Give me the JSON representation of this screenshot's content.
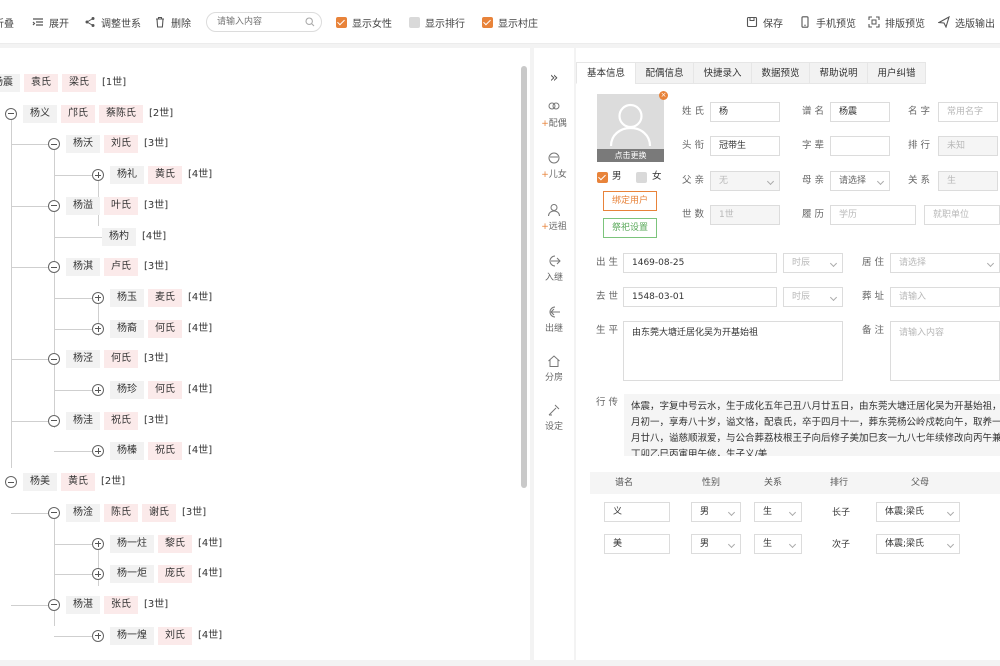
{
  "toolbar": {
    "collapse": "折叠",
    "expand": "展开",
    "adjust": "调整世系",
    "delete": "删除",
    "search_placeholder": "请输入内容",
    "show_female": "显示女性",
    "show_rank": "显示排行",
    "show_village": "显示村庄",
    "save": "保存",
    "phone_preview": "手机预览",
    "layout_preview": "排版预览",
    "export": "选版输出"
  },
  "tree": {
    "root": {
      "name": "杨震",
      "spouses": [
        "袁氏",
        "梁氏"
      ],
      "gen": "[1世]"
    },
    "nodes": [
      {
        "name": "杨义",
        "spouses": [
          "邝氏",
          "蔡陈氏"
        ],
        "gen": "[2世]"
      },
      {
        "name": "杨沃",
        "spouses": [
          "刘氏"
        ],
        "gen": "[3世]"
      },
      {
        "name": "杨礼",
        "spouses": [
          "黄氏"
        ],
        "gen": "[4世]"
      },
      {
        "name": "杨溢",
        "spouses": [
          "叶氏"
        ],
        "gen": "[3世]"
      },
      {
        "name": "杨杓",
        "spouses": [],
        "gen": "[4世]"
      },
      {
        "name": "杨淇",
        "spouses": [
          "卢氏"
        ],
        "gen": "[3世]"
      },
      {
        "name": "杨玉",
        "spouses": [
          "麦氏"
        ],
        "gen": "[4世]"
      },
      {
        "name": "杨裔",
        "spouses": [
          "何氏"
        ],
        "gen": "[4世]"
      },
      {
        "name": "杨泾",
        "spouses": [
          "何氏"
        ],
        "gen": "[3世]"
      },
      {
        "name": "杨珍",
        "spouses": [
          "何氏"
        ],
        "gen": "[4世]"
      },
      {
        "name": "杨洼",
        "spouses": [
          "祝氏"
        ],
        "gen": "[3世]"
      },
      {
        "name": "杨榛",
        "spouses": [
          "祝氏"
        ],
        "gen": "[4世]"
      },
      {
        "name": "杨美",
        "spouses": [
          "黄氏"
        ],
        "gen": "[2世]"
      },
      {
        "name": "杨淦",
        "spouses": [
          "陈氏",
          "谢氏"
        ],
        "gen": "[3世]"
      },
      {
        "name": "杨一炷",
        "spouses": [
          "黎氏"
        ],
        "gen": "[4世]"
      },
      {
        "name": "杨一炬",
        "spouses": [
          "庞氏"
        ],
        "gen": "[4世]"
      },
      {
        "name": "杨湛",
        "spouses": [
          "张氏"
        ],
        "gen": "[3世]"
      },
      {
        "name": "杨一煌",
        "spouses": [
          "刘氏"
        ],
        "gen": "[4世]"
      }
    ]
  },
  "sidenav": {
    "expand_icon": "»",
    "items": [
      {
        "label": "配偶",
        "icon": "couple-icon",
        "plus": true
      },
      {
        "label": "儿女",
        "icon": "child-icon",
        "plus": true
      },
      {
        "label": "远祖",
        "icon": "ancestor-icon",
        "plus": true
      },
      {
        "label": "入继",
        "icon": "adopt-in-icon",
        "plus": false
      },
      {
        "label": "出继",
        "icon": "adopt-out-icon",
        "plus": false
      },
      {
        "label": "分房",
        "icon": "house-icon",
        "plus": false
      },
      {
        "label": "设定",
        "icon": "settings-icon",
        "plus": false
      }
    ]
  },
  "form": {
    "tabs": [
      "基本信息",
      "配偶信息",
      "快捷录入",
      "数据预览",
      "帮助说明",
      "用户纠错"
    ],
    "avatar_caption": "点击更换",
    "gender_male": "男",
    "gender_female": "女",
    "bind_user": "绑定用户",
    "memorial": "祭祀设置",
    "labels": {
      "surname": "姓 氏",
      "genealogy_name": "谱 名",
      "given_name": "名 字",
      "title": "头 衔",
      "courtesy": "字 辈",
      "rank": "排 行",
      "father": "父 亲",
      "mother": "母 亲",
      "relation": "关 系",
      "generation": "世 数",
      "resume": "履 历",
      "birth": "出 生",
      "residence": "居 住",
      "death": "去 世",
      "burial": "葬 址",
      "life": "生 平",
      "note": "备 注",
      "biography": "行 传"
    },
    "values": {
      "surname": "杨",
      "genealogy_name": "杨震",
      "given_name_ph": "常用名字",
      "title": "冠带生",
      "courtesy": "",
      "rank_ph": "未知",
      "father": "无",
      "mother_ph": "请选择",
      "relation": "生",
      "generation": "1世",
      "resume_ph": "学历",
      "work_ph": "就职单位",
      "birth_date": "1469-08-25",
      "birth_time_ph": "时辰",
      "residence_ph": "请选择",
      "death_date": "1548-03-01",
      "death_time_ph": "时辰",
      "burial_ph": "请输入",
      "life": "由东莞大塘迁居化吴为开基始祖",
      "note_ph": "请输入内容",
      "biography_lines": [
        "体震，字复中号云水，生于成化五年己丑八月廿五日，由东莞大塘迁居化吴为开基始祖，卒",
        "月初一，享寿八十岁，谥文恪，配袁氏，卒于四月十一，葬东莞杨公岭戍乾向午，取养一子",
        "月廿八，谥慈顺淑爱，与公合葬荔枝根王子向后修子美加巳亥一九八七年续修改向丙午兼王",
        "丁卯乙巳丙寅甲午修，生子义/美"
      ]
    },
    "children_table": {
      "headers": [
        "谱名",
        "性别",
        "关系",
        "排行",
        "父母"
      ],
      "rows": [
        {
          "name": "义",
          "gender": "男",
          "relation": "生",
          "rank": "长子",
          "parents": "体震;梁氏"
        },
        {
          "name": "美",
          "gender": "男",
          "relation": "生",
          "rank": "次子",
          "parents": "体震;梁氏"
        }
      ]
    }
  }
}
